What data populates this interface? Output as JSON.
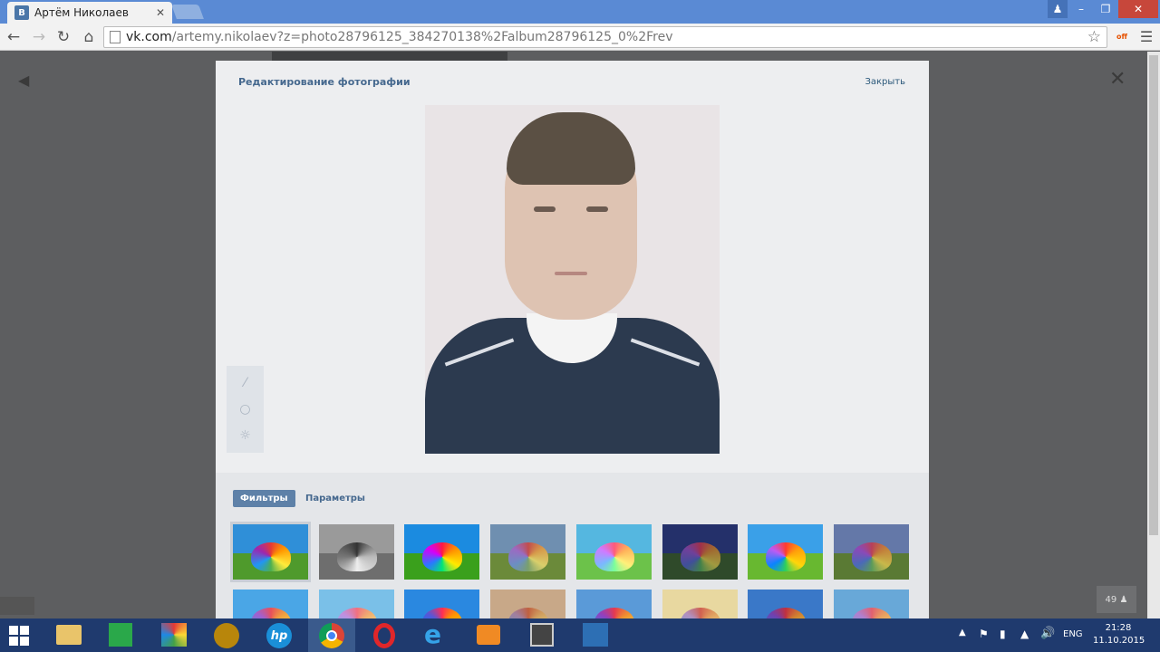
{
  "browser": {
    "tab_title": "Артём Николаев",
    "tab_favicon": "В",
    "tab_close": "✕",
    "url_host": "vk.com",
    "url_rest": "/artemy.nikolaev?z=photo28796125_384270138%2Falbum28796125_0%2Frev",
    "ext_badge": "off"
  },
  "editor": {
    "title": "Редактирование фотографии",
    "close_label": "Закрыть",
    "tabs": [
      {
        "label": "Фильтры",
        "active": true
      },
      {
        "label": "Параметры",
        "active": false
      }
    ],
    "tools": [
      {
        "icon": "auto-enhance-icon",
        "glyph": "⁄"
      },
      {
        "icon": "drop-icon",
        "glyph": "○"
      },
      {
        "icon": "brightness-icon",
        "glyph": "☼"
      }
    ],
    "filters": [
      {
        "sky": "#2f8fd8",
        "field": "#4f9a2c",
        "umbrella": "conic-gradient(#e53935,#ff9800,#ffeb3b,#4caf50,#2196f3,#9c27b0,#e53935)"
      },
      {
        "sky": "#9a9a9a",
        "field": "#6e6e6e",
        "umbrella": "conic-gradient(#333,#bbb,#eee,#777,#333)"
      },
      {
        "sky": "#1b8be0",
        "field": "#3aa01c",
        "umbrella": "conic-gradient(#ff1744,#ff9100,#ffea00,#00e676,#2979ff,#d500f9,#ff1744)"
      },
      {
        "sky": "#6f8fb0",
        "field": "#6b8a3a",
        "umbrella": "conic-gradient(#c24d4d,#d69a4b,#d9cf6b,#7aa06b,#6b8fc2,#9a6bc2,#c24d4d)"
      },
      {
        "sky": "#55b7e0",
        "field": "#6cc24a",
        "umbrella": "conic-gradient(#ff5a7a,#ffb35a,#fff07a,#7aff9a,#7ab8ff,#d07aff,#ff5a7a)"
      },
      {
        "sky": "#24306a",
        "field": "#2f4a2a",
        "umbrella": "conic-gradient(#a0304a,#a06a30,#a09a40,#40804a,#404f9a,#70409a,#a0304a)"
      },
      {
        "sky": "#3aa0e8",
        "field": "#68b830",
        "umbrella": "conic-gradient(#ff3b30,#ff9f0a,#ffd60a,#30d158,#0a84ff,#bf5af2,#ff3b30)"
      },
      {
        "sky": "#6478a8",
        "field": "#5a7a34",
        "umbrella": "conic-gradient(#b8405a,#c2803a,#c8b84a,#5a9a5a,#4a6ab8,#8a4ab8,#b8405a)"
      },
      {
        "sky": "#4aa6e6",
        "field": "#5cb040",
        "umbrella": "conic-gradient(#e8505a,#f0a040,#f5e050,#60c060,#4a90e0,#a060d0,#e8505a)"
      },
      {
        "sky": "#7ac0e8",
        "field": "#80c060",
        "umbrella": "conic-gradient(#f07080,#f0b070,#f5e590,#90d090,#80b0f0,#c090e0,#f07080)"
      },
      {
        "sky": "#2a88e0",
        "field": "#40a030",
        "umbrella": "conic-gradient(#ff2d55,#ff9500,#ffcc00,#4cd964,#007aff,#5856d6,#ff2d55)"
      },
      {
        "sky": "#c8a888",
        "field": "#9a8a58",
        "umbrella": "conic-gradient(#c06040,#d0a060,#e0d080,#90a070,#7090b0,#a080a0,#c06040)"
      },
      {
        "sky": "#5a9ad8",
        "field": "#4a9a30",
        "umbrella": "conic-gradient(#e53950,#f09030,#f0e040,#40b050,#3080e0,#9040c0,#e53950)"
      },
      {
        "sky": "#e8d8a0",
        "field": "#b8b068",
        "umbrella": "conic-gradient(#d06050,#e0a060,#f0e080,#a0c080,#80a0d0,#b090c0,#d06050)"
      },
      {
        "sky": "#3a78c8",
        "field": "#3a8028",
        "umbrella": "conic-gradient(#c03040,#d08030,#d8c840,#40a050,#3070c8,#7040b0,#c03040)"
      },
      {
        "sky": "#68a8d8",
        "field": "#70a848",
        "umbrella": "conic-gradient(#e06070,#e8a060,#efd870,#80c080,#70a0d8,#b080d0,#e06070)"
      }
    ]
  },
  "viewer": {
    "online_count": "49"
  },
  "taskbar": {
    "lang": "ENG",
    "time": "21:28",
    "date": "11.10.2015"
  },
  "colors": {
    "accent": "#5e81a8",
    "link": "#45688e",
    "chrome_frame": "#5a8ad4",
    "taskbar": "#1f3a6e"
  }
}
